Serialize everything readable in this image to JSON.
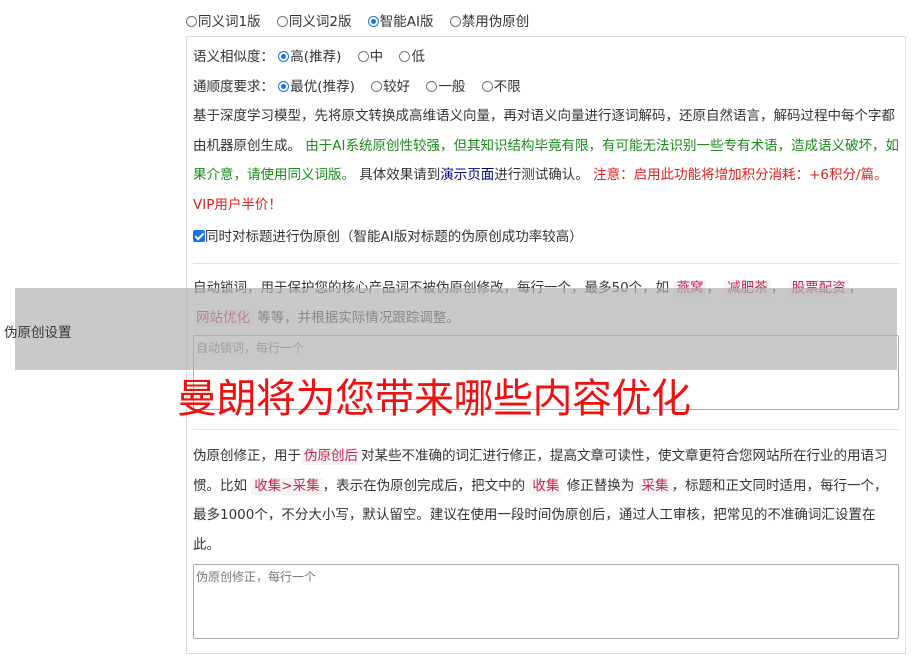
{
  "side_label": "伪原创设置",
  "mode_options": [
    {
      "label": "同义词1版",
      "selected": false
    },
    {
      "label": "同义词2版",
      "selected": false
    },
    {
      "label": "智能AI版",
      "selected": true
    },
    {
      "label": "禁用伪原创",
      "selected": false
    }
  ],
  "similarity": {
    "label": "语义相似度：",
    "options": [
      {
        "label": "高(推荐)",
        "selected": true
      },
      {
        "label": "中",
        "selected": false
      },
      {
        "label": "低",
        "selected": false
      }
    ]
  },
  "fluency": {
    "label": "通顺度要求：",
    "options": [
      {
        "label": "最优(推荐)",
        "selected": true
      },
      {
        "label": "较好",
        "selected": false
      },
      {
        "label": "一般",
        "selected": false
      },
      {
        "label": "不限",
        "selected": false
      }
    ]
  },
  "description": {
    "part1": "基于深度学习模型，先将原文转换成高维语义向量，再对语义向量进行逐词解码，还原自然语言，解码过程中每个字都由机器原创生成。",
    "part2_green": "由于AI系统原创性较强，但其知识结构毕竟有限，有可能无法识别一些专有术语，造成语义破坏，如果介意，请使用同义词版。",
    "part3": "具体效果请到",
    "demo_link": "演示页面",
    "part4": "进行测试确认。",
    "part5_red": "注意：启用此功能将增加积分消耗：+6积分/篇。VIP用户半价！"
  },
  "title_checkbox": {
    "label": "同时对标题进行伪原创（智能AI版对标题的伪原创成功率较高）",
    "checked": true
  },
  "lock_words": {
    "intro1": "自动锁词，用于保护您的核心产品词不被伪原创修改，每行一个，最多50个，如",
    "examples": [
      "燕窝",
      "减肥茶",
      "股票配资",
      "网站优化"
    ],
    "intro2": "等等，并根据实际情况跟踪调整。",
    "placeholder": "自动锁词，每行一个"
  },
  "correction": {
    "intro1": "伪原创修正，用于",
    "tag1": "伪原创后",
    "intro2": "对某些不准确的词汇进行修正，提高文章可读性，使文章更符合您网站所在行业的用语习惯。比如",
    "tag2": "收集>采集",
    "intro3": "，表示在伪原创完成后，把文中的",
    "tag3": "收集",
    "intro4": "修正替换为",
    "tag4": "采集",
    "intro5": "，标题和正文同时适用，每行一个，最多1000个，不分大小写，默认留空。建议在使用一段时间伪原创后，通过人工审核，把常见的不准确词汇设置在此。",
    "placeholder": "伪原创修正，每行一个"
  },
  "overlay_title": "曼朗将为您带来哪些内容优化",
  "colors": {
    "accent": "#1a73e8",
    "green": "#1a8a1a",
    "red": "#e02020",
    "tag": "#c7254e"
  }
}
